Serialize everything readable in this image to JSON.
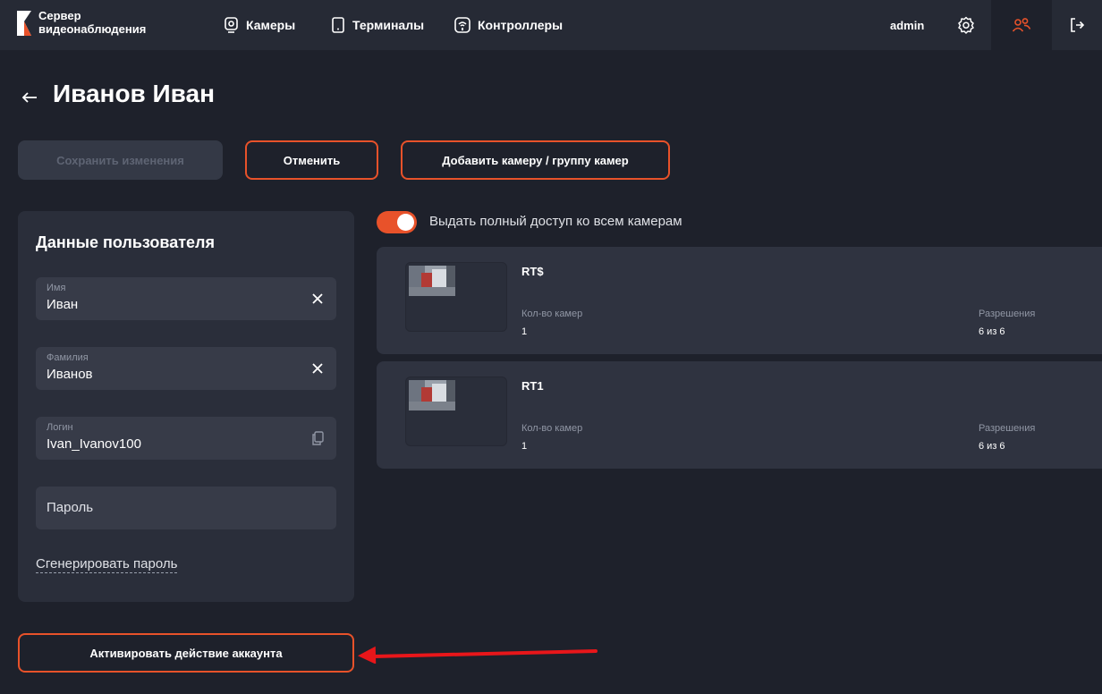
{
  "header": {
    "logo_line1": "Сервер",
    "logo_line2": "видеонаблюдения",
    "nav": [
      {
        "label": "Камеры",
        "icon": "camera-icon"
      },
      {
        "label": "Терминалы",
        "icon": "terminal-icon"
      },
      {
        "label": "Контроллеры",
        "icon": "controller-icon"
      }
    ],
    "user": "admin"
  },
  "page": {
    "title": "Иванов Иван"
  },
  "actions": {
    "save": "Сохранить изменения",
    "cancel": "Отменить",
    "add_camera": "Добавить камеру / группу камер",
    "activate": "Активировать действие аккаунта"
  },
  "user_panel": {
    "title": "Данные пользователя",
    "first_name": {
      "label": "Имя",
      "value": "Иван"
    },
    "last_name": {
      "label": "Фамилия",
      "value": "Иванов"
    },
    "login": {
      "label": "Логин",
      "value": "Ivan_Ivanov100"
    },
    "password": {
      "placeholder": "Пароль"
    },
    "generate_link": "Сгенерировать пароль"
  },
  "access": {
    "full_access_label": "Выдать полный доступ ко всем камерам",
    "full_access_on": true
  },
  "cameras": [
    {
      "name": "RT$",
      "count_label": "Кол-во камер",
      "count": "1",
      "perm_label": "Разрешения",
      "perm": "6 из 6"
    },
    {
      "name": "RT1",
      "count_label": "Кол-во камер",
      "count": "1",
      "perm_label": "Разрешения",
      "perm": "6 из 6"
    }
  ],
  "colors": {
    "accent": "#e8522a",
    "background": "#1e212b",
    "panel": "#2a2e3a"
  }
}
